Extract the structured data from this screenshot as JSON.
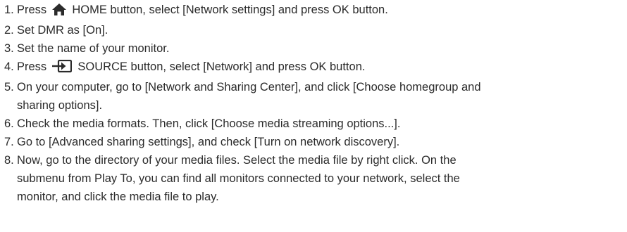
{
  "steps": [
    {
      "number": "1.",
      "before": "Press",
      "icon": "home-icon",
      "after": "HOME button, select [Network settings] and press OK button."
    },
    {
      "number": "2.",
      "text": "Set DMR as [On]."
    },
    {
      "number": "3.",
      "text": "Set the name of your monitor."
    },
    {
      "number": "4.",
      "before": "Press",
      "icon": "source-icon",
      "after": "SOURCE button, select [Network] and press OK button."
    },
    {
      "number": "5.",
      "lines": [
        "On your computer, go to [Network and Sharing Center], and click [Choose homegroup and",
        "sharing options]."
      ]
    },
    {
      "number": "6.",
      "text": "Check the media formats. Then, click [Choose media streaming options...]."
    },
    {
      "number": "7.",
      "text": "Go to [Advanced sharing settings], and check [Turn on network discovery]."
    },
    {
      "number": "8.",
      "lines": [
        "Now, go to the directory of your media files. Select the media file by right click. On the",
        "submenu from Play To, you can find all monitors connected to your network, select the",
        "monitor, and click the media file to play."
      ]
    }
  ]
}
